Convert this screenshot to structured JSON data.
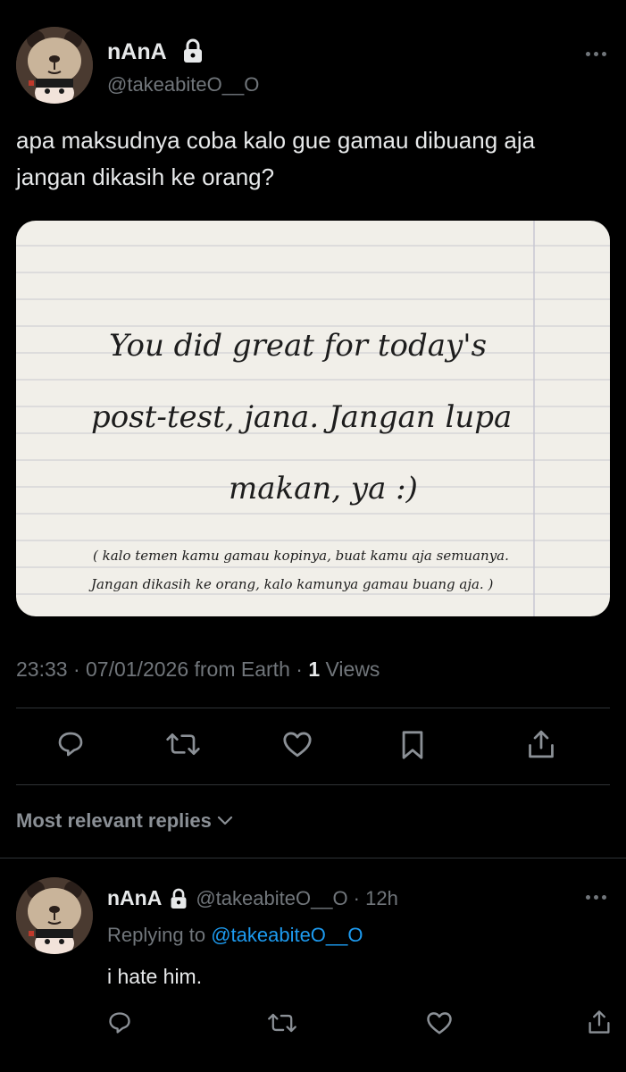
{
  "tweet": {
    "author_name": "nAnA",
    "author_handle": "@takeabiteO__O",
    "text_line1": "apa maksudnya coba kalo gue gamau dibuang aja",
    "text_line2": "jangan dikasih ke orang?",
    "meta_time_date": "23:33 · 07/01/2026 from Earth · ",
    "views_count": "1",
    "views_label": " Views",
    "image_note": {
      "line1": "You did great for today's",
      "line2": "post-test, jana. Jangan lupa",
      "line3": "makan, ya :)",
      "small1": "( kalo temen kamu gamau kopinya, buat kamu aja semuanya.",
      "small2": "Jangan dikasih ke orang, kalo kamunya gamau buang aja. )"
    }
  },
  "actions": [
    "reply-icon",
    "retweet-icon",
    "like-icon",
    "bookmark-icon",
    "share-icon"
  ],
  "replies_header": {
    "label": "Most relevant replies"
  },
  "reply": {
    "author_name": "nAnA",
    "author_handle": "@takeabiteO__O",
    "time": "· 12h",
    "replying_prefix": "Replying to ",
    "replying_to": "@takeabiteO__O",
    "text": "i hate him."
  },
  "colors": {
    "background": "#000000",
    "text": "#e7e9ea",
    "secondary": "#71767b",
    "link": "#1d9bf0",
    "divider": "#2f3336"
  }
}
